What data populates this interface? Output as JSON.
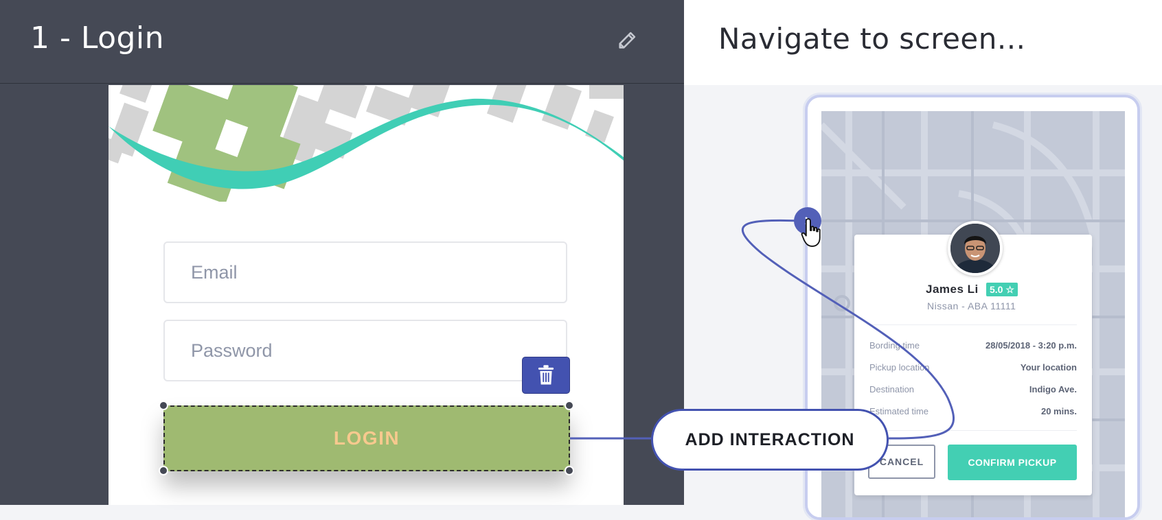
{
  "editor": {
    "screen_title": "1 - Login",
    "email_placeholder": "Email",
    "password_placeholder": "Password",
    "login_label": "LOGIN",
    "add_interaction_label": "ADD INTERACTION"
  },
  "navigate": {
    "title": "Navigate to screen..."
  },
  "target_screen": {
    "driver_name": "James Li",
    "rating": "5.0",
    "car_info": "Nissan - ABA 11111",
    "details": [
      {
        "label": "Bording time",
        "value": "28/05/2018 - 3:20 p.m."
      },
      {
        "label": "Pickup location",
        "value": "Your location"
      },
      {
        "label": "Destination",
        "value": "Indigo Ave."
      },
      {
        "label": "Estimated time",
        "value": "20 mins."
      }
    ],
    "cancel_label": "CANCEL",
    "confirm_label": "CONFIRM PICKUP"
  },
  "colors": {
    "panel_dark": "#454955",
    "accent_blue": "#4352b0",
    "teal": "#43cfb3",
    "login_green": "#9fba71",
    "login_text": "#f7c98e"
  }
}
